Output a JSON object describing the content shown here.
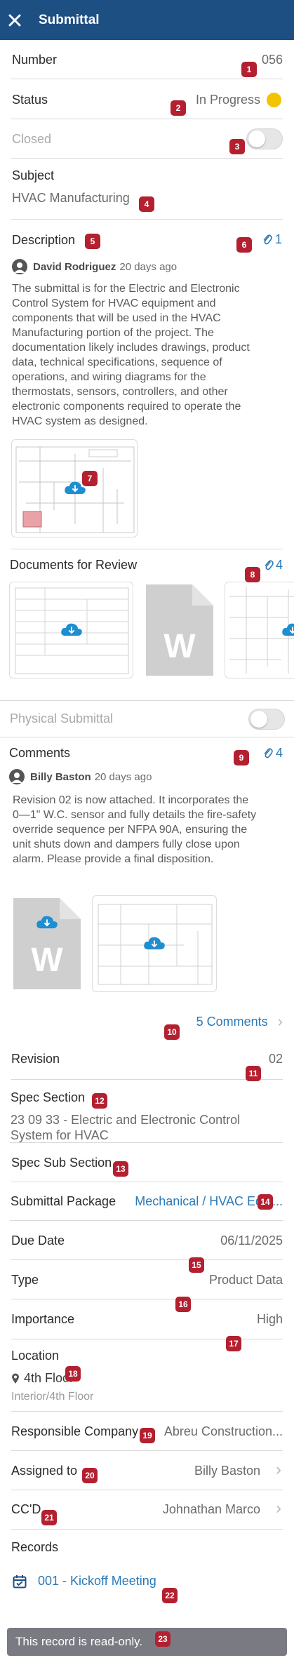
{
  "header": {
    "title": "Submittal"
  },
  "fields": {
    "number": {
      "label": "Number",
      "value": "056"
    },
    "status": {
      "label": "Status",
      "value": "In Progress",
      "dot_color": "#f3c300"
    },
    "closed": {
      "label": "Closed"
    },
    "subject": {
      "label": "Subject",
      "value": "HVAC Manufacturing"
    },
    "description": {
      "label": "Description",
      "attach_count": "1",
      "author": "David Rodriguez",
      "time": "20 days ago",
      "lines": [
        "The submittal is for the Electric and Electronic",
        "Control System for HVAC equipment and",
        "components that will be used in the HVAC",
        "Manufacturing portion of the project. The",
        "documentation likely includes drawings, product",
        "data, technical specifications, sequence of",
        "operations, and wiring diagrams for the",
        "thermostats, sensors, controllers, and other",
        "electronic components required to operate the",
        "HVAC system as designed."
      ]
    },
    "docs_review": {
      "label": "Documents for Review",
      "attach_count": "4"
    },
    "physical": {
      "label": "Physical Submittal"
    },
    "comments": {
      "label": "Comments",
      "attach_count": "4",
      "author": "Billy Baston",
      "time": "20 days ago",
      "lines": [
        "Revision 02 is now attached. It incorporates the",
        "0—1\" W.C. sensor and fully details the fire-safety",
        "override sequence per NFPA 90A, ensuring the",
        "unit shuts down and dampers fully close upon",
        "alarm. Please provide a final disposition."
      ],
      "more_link": "5 Comments"
    },
    "revision": {
      "label": "Revision",
      "value": "02"
    },
    "spec_section": {
      "label": "Spec Section",
      "line1": "23 09 33 - Electric and Electronic Control",
      "line2": "System for HVAC"
    },
    "spec_sub_section": {
      "label": "Spec Sub Section"
    },
    "package": {
      "label": "Submittal Package",
      "value": "Mechanical / HVAC Equi..."
    },
    "due_date": {
      "label": "Due Date",
      "value": "06/11/2025"
    },
    "type": {
      "label": "Type",
      "value": "Product Data"
    },
    "importance": {
      "label": "Importance",
      "value": "High"
    },
    "location": {
      "label": "Location",
      "value": "4th Floor",
      "path": "Interior/4th Floor"
    },
    "company": {
      "label": "Responsible Company",
      "value": "Abreu Construction..."
    },
    "assigned": {
      "label": "Assigned to",
      "value": "Billy Baston"
    },
    "ccd": {
      "label": "CC'D",
      "value": "Johnathan Marco"
    },
    "records": {
      "label": "Records",
      "item": "001 - Kickoff Meeting"
    }
  },
  "footer": {
    "readonly": "This record is read-only."
  },
  "badges": [
    "1",
    "2",
    "3",
    "4",
    "5",
    "6",
    "7",
    "8",
    "9",
    "10",
    "11",
    "12",
    "13",
    "14",
    "15",
    "16",
    "17",
    "18",
    "19",
    "20",
    "21",
    "22",
    "23"
  ],
  "colors": {
    "brand": "#1d4f82",
    "link": "#2a7ab8",
    "badge": "#b32030"
  },
  "icons": {
    "close": "close-icon",
    "paperclip": "paperclip-icon",
    "chevron": "chevron-right-icon",
    "cloud": "cloud-download-icon",
    "location": "location-pin-icon",
    "calendar": "calendar-icon",
    "user": "user-avatar-icon"
  }
}
